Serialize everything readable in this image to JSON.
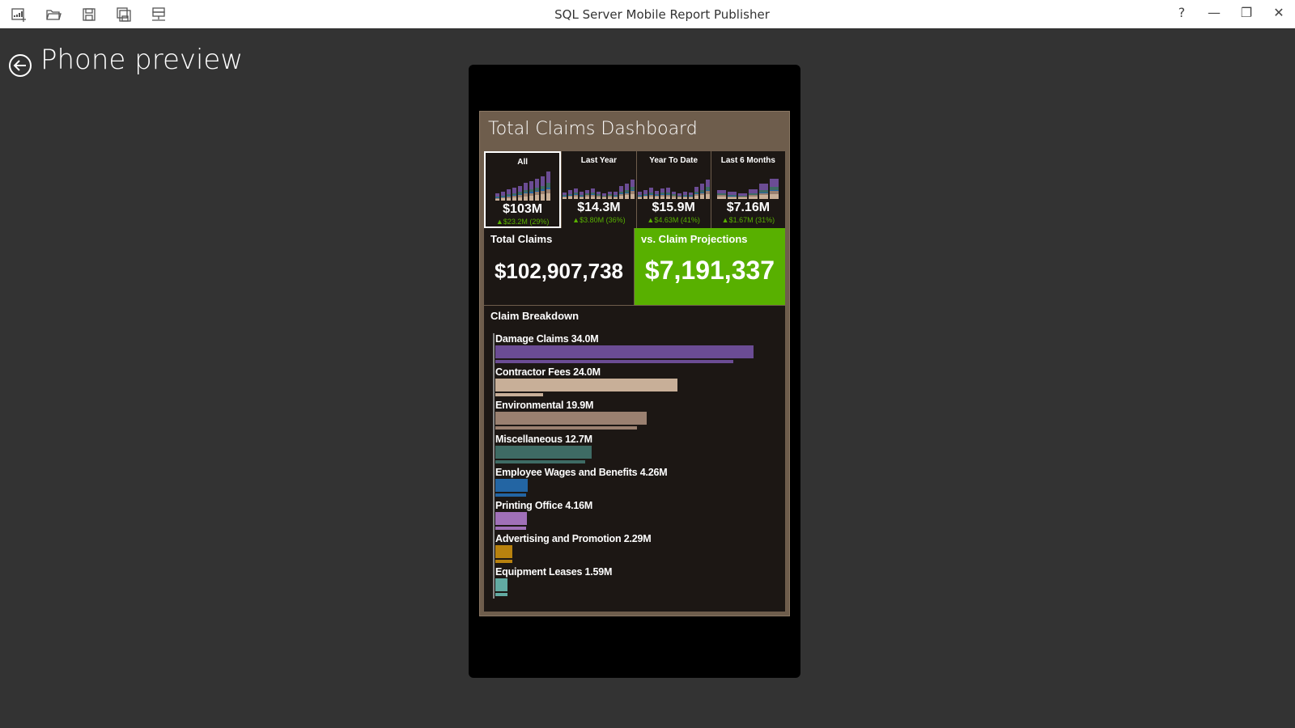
{
  "app": {
    "title": "SQL Server Mobile Report Publisher"
  },
  "toolbar": [
    {
      "name": "new-report-icon"
    },
    {
      "name": "open-folder-icon"
    },
    {
      "name": "save-icon"
    },
    {
      "name": "save-as-icon"
    },
    {
      "name": "server-icon"
    }
  ],
  "window_controls": {
    "help": "?",
    "minimize": "—",
    "restore": "❐",
    "close": "✕"
  },
  "page": {
    "title": "Phone preview"
  },
  "dashboard": {
    "title": "Total Claims Dashboard",
    "colors": {
      "background": "#6e5d4c",
      "panel": "#1c1714",
      "accent_green": "#58b000"
    },
    "tiles": [
      {
        "label": "All",
        "value": "$103M",
        "delta": "▲$23.2M (29%)",
        "selected": true,
        "spark": [
          12,
          15,
          19,
          22,
          25,
          30,
          33,
          38,
          42,
          50
        ]
      },
      {
        "label": "Last Year",
        "value": "$14.3M",
        "delta": "▲$3.80M (36%)",
        "selected": false,
        "spark": [
          11,
          15,
          18,
          12,
          16,
          18,
          13,
          10,
          13,
          12,
          22,
          26,
          34
        ]
      },
      {
        "label": "Year To Date",
        "value": "$15.9M",
        "delta": "▲$4.63M (41%)",
        "selected": false,
        "spark": [
          12,
          15,
          19,
          14,
          18,
          19,
          13,
          10,
          12,
          11,
          21,
          26,
          34
        ]
      },
      {
        "label": "Last 6 Months",
        "value": "$7.16M",
        "delta": "▲$1.67M (31%)",
        "selected": false,
        "spark": [
          16,
          12,
          10,
          17,
          26,
          35
        ]
      }
    ],
    "total_claims": {
      "label": "Total Claims",
      "value": "$102,907,738"
    },
    "vs_projections": {
      "label": "vs. Claim Projections",
      "value": "$7,191,337"
    },
    "chart_data": {
      "type": "bar",
      "title": "Claim Breakdown",
      "orientation": "horizontal",
      "unit": "M",
      "categories": [
        "Damage Claims",
        "Contractor Fees",
        "Environmental",
        "Miscellaneous",
        "Employee Wages and Benefits",
        "Printing Office",
        "Advertising and Promotion",
        "Equipment Leases"
      ],
      "labels": [
        "34.0M",
        "24.0M",
        "19.9M",
        "12.7M",
        "4.26M",
        "4.16M",
        "2.29M",
        "1.59M"
      ],
      "values": [
        34.0,
        24.0,
        19.9,
        12.7,
        4.26,
        4.16,
        2.29,
        1.59
      ],
      "comparison_values": [
        31.3,
        6.3,
        18.7,
        11.8,
        4.0,
        4.0,
        2.2,
        1.6
      ],
      "colors": [
        "#6b4c94",
        "#c8af98",
        "#9a8070",
        "#3e6b64",
        "#2365a3",
        "#a070b8",
        "#b8820e",
        "#62aaa2"
      ]
    }
  }
}
